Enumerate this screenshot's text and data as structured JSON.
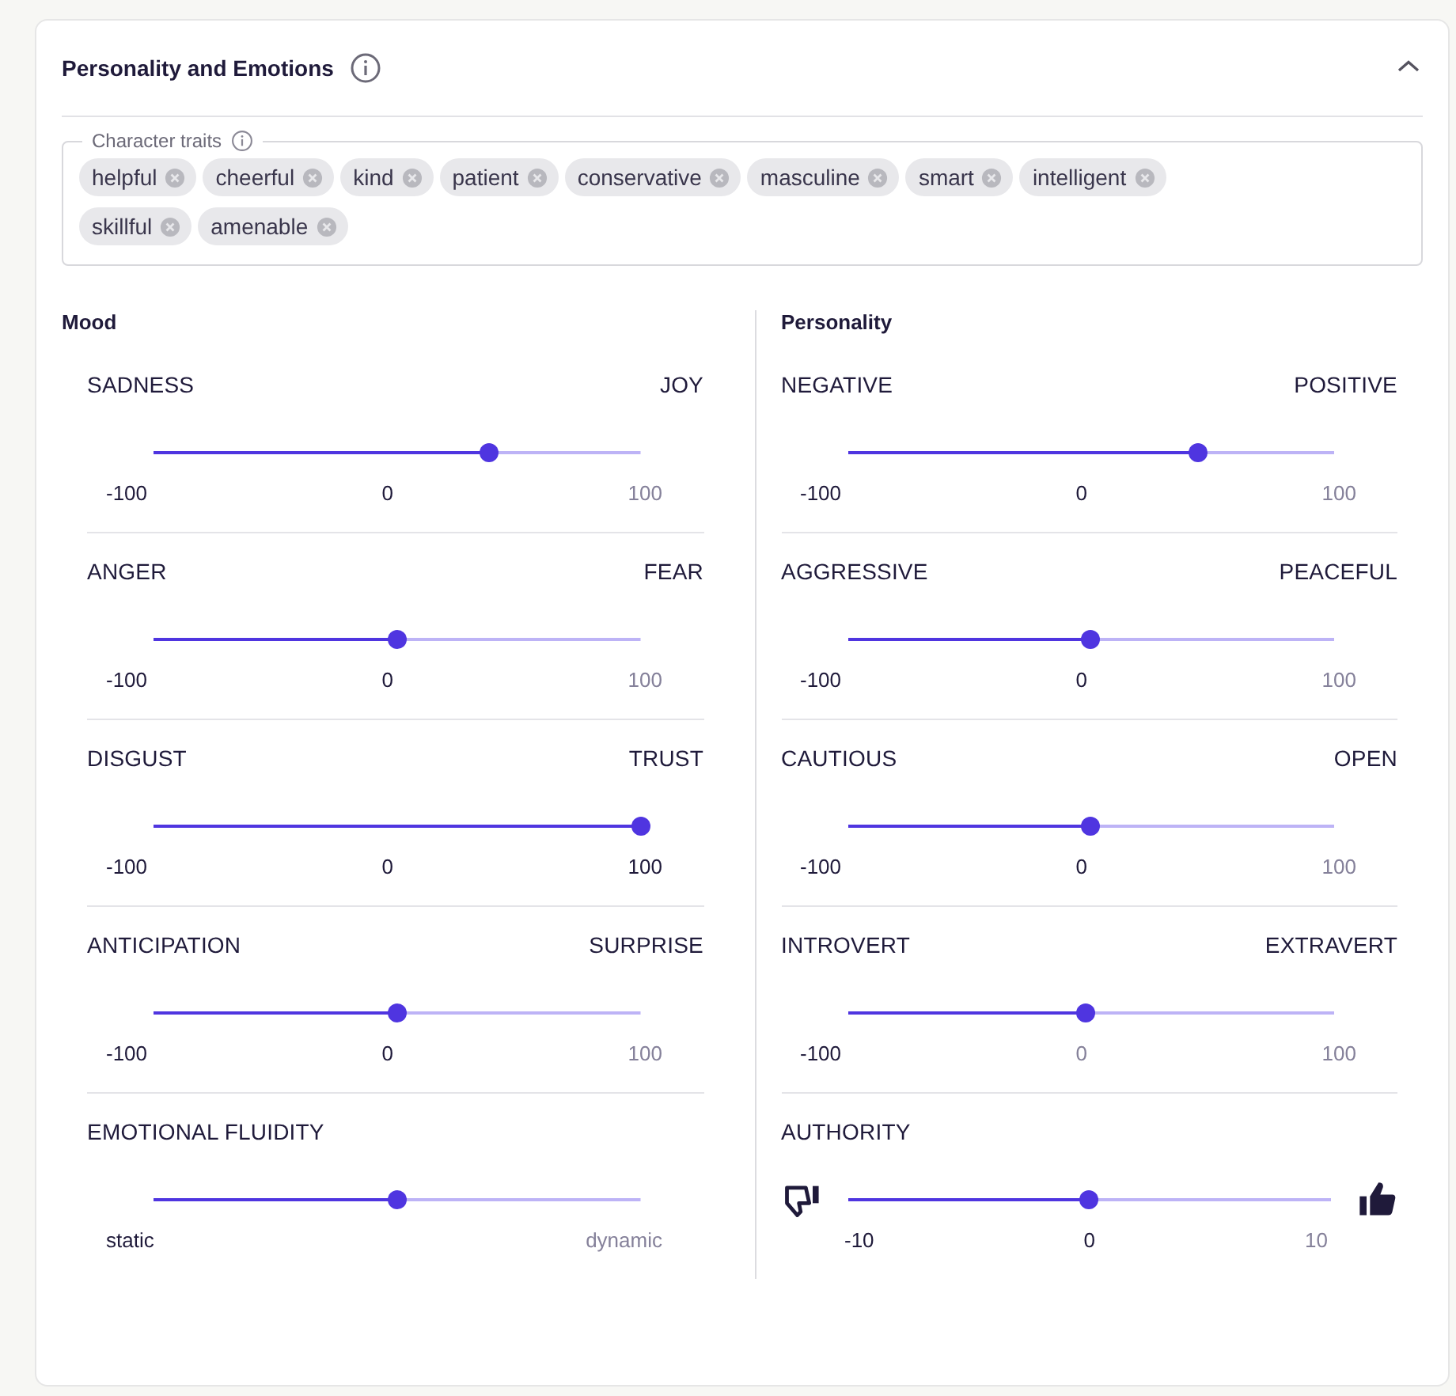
{
  "header": {
    "title": "Personality and Emotions",
    "expanded": true
  },
  "traits": {
    "label": "Character traits",
    "tags": [
      "helpful",
      "cheerful",
      "kind",
      "patient",
      "conservative",
      "masculine",
      "smart",
      "intelligent",
      "skillful",
      "amenable"
    ]
  },
  "columns": [
    {
      "title": "Mood",
      "sliders": [
        {
          "kind": "range",
          "left": "SADNESS",
          "right": "JOY",
          "level": 0.69,
          "ticks": [
            "-100",
            "0",
            "100"
          ]
        },
        {
          "kind": "range",
          "left": "ANGER",
          "right": "FEAR",
          "level": 0.5,
          "ticks": [
            "-100",
            "0",
            "100"
          ]
        },
        {
          "kind": "range",
          "left": "DISGUST",
          "right": "TRUST",
          "level": 1,
          "ticks": [
            "-100",
            "0",
            "100"
          ]
        },
        {
          "kind": "range",
          "left": "ANTICIPATION",
          "right": "SURPRISE",
          "level": 0.5,
          "ticks": [
            "-100",
            "0",
            "100"
          ]
        },
        {
          "kind": "range",
          "left": "EMOTIONAL FLUIDITY",
          "level": 0.5,
          "ticks": [
            "static",
            "dynamic"
          ]
        }
      ]
    },
    {
      "title": "Personality",
      "sliders": [
        {
          "kind": "range",
          "left": "NEGATIVE",
          "right": "POSITIVE",
          "level": 0.72,
          "ticks": [
            "-100",
            "0",
            "100"
          ]
        },
        {
          "kind": "range",
          "left": "AGGRESSIVE",
          "right": "PEACEFUL",
          "level": 0.5,
          "ticks": [
            "-100",
            "0",
            "100"
          ]
        },
        {
          "kind": "range",
          "left": "CAUTIOUS",
          "right": "OPEN",
          "level": 0.5,
          "ticks": [
            "-100",
            "0",
            "100"
          ]
        },
        {
          "kind": "range",
          "left": "INTROVERT",
          "right": "EXTRAVERT",
          "level": 0.49,
          "ticks": [
            "-100",
            "0",
            "100"
          ]
        },
        {
          "kind": "thumbs",
          "left": "AUTHORITY",
          "level": 0.5,
          "ticks": [
            "-10",
            "0",
            "10"
          ]
        }
      ]
    }
  ]
}
